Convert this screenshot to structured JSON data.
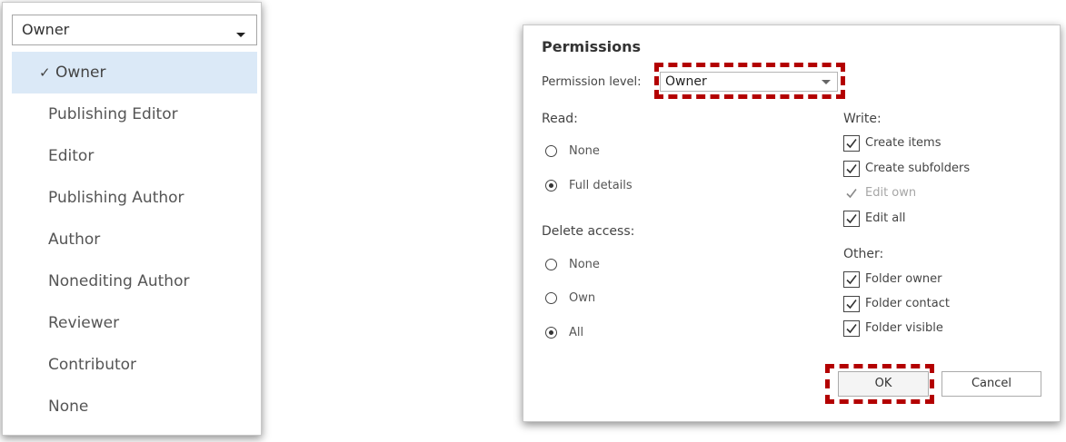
{
  "dropdown": {
    "selected_value": "Owner",
    "options": [
      {
        "label": "Owner",
        "selected": true
      },
      {
        "label": "Publishing Editor",
        "selected": false
      },
      {
        "label": "Editor",
        "selected": false
      },
      {
        "label": "Publishing Author",
        "selected": false
      },
      {
        "label": "Author",
        "selected": false
      },
      {
        "label": "Nonediting Author",
        "selected": false
      },
      {
        "label": "Reviewer",
        "selected": false
      },
      {
        "label": "Contributor",
        "selected": false
      },
      {
        "label": "None",
        "selected": false
      }
    ],
    "check_glyph": "✓"
  },
  "dialog": {
    "title": "Permissions",
    "permission_level_label": "Permission level:",
    "permission_level_value": "Owner",
    "read": {
      "heading": "Read:",
      "options": [
        {
          "label": "None",
          "selected": false
        },
        {
          "label": "Full details",
          "selected": true
        }
      ]
    },
    "delete_access": {
      "heading": "Delete access:",
      "options": [
        {
          "label": "None",
          "selected": false
        },
        {
          "label": "Own",
          "selected": false
        },
        {
          "label": "All",
          "selected": true
        }
      ]
    },
    "write": {
      "heading": "Write:",
      "items": [
        {
          "label": "Create items",
          "checked": true,
          "disabled": false
        },
        {
          "label": "Create subfolders",
          "checked": true,
          "disabled": false
        },
        {
          "label": "Edit own",
          "checked": true,
          "disabled": true
        },
        {
          "label": "Edit all",
          "checked": true,
          "disabled": false
        }
      ]
    },
    "other": {
      "heading": "Other:",
      "items": [
        {
          "label": "Folder owner",
          "checked": true
        },
        {
          "label": "Folder contact",
          "checked": true
        },
        {
          "label": "Folder visible",
          "checked": true
        }
      ]
    },
    "ok_label": "OK",
    "cancel_label": "Cancel"
  },
  "colors": {
    "highlight": "#b30000",
    "selected_item_bg": "#dbe9f7"
  }
}
